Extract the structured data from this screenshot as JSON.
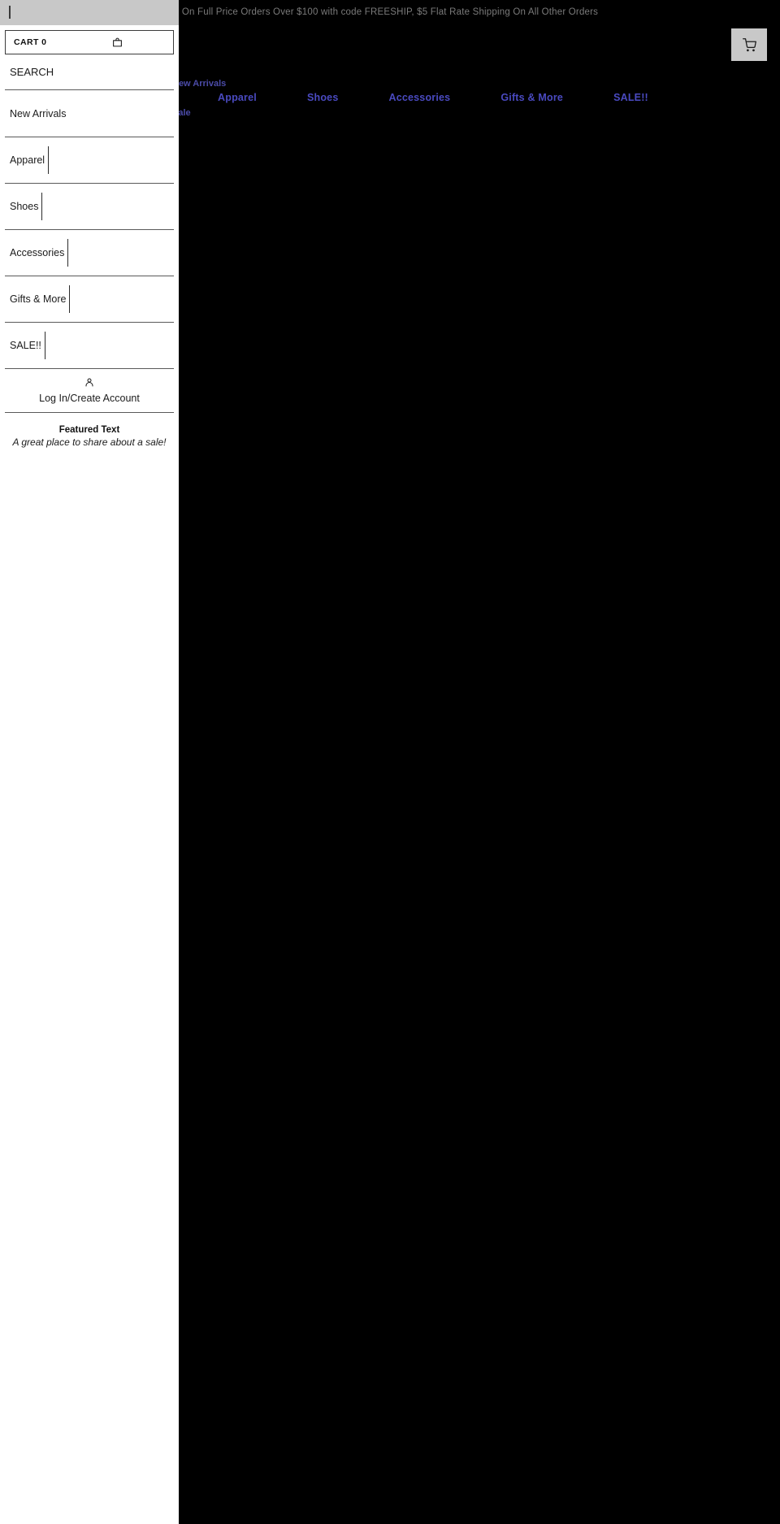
{
  "promo": {
    "text": "On Full Price Orders Over $100 with code FREESHIP, $5 Flat Rate Shipping On All Other Orders"
  },
  "header": {
    "cart_icon": "shopping-cart-icon"
  },
  "background_nav": {
    "new_arrivals": "New Arrivals",
    "sale_fragment": "Sale",
    "items": [
      {
        "label": "Apparel"
      },
      {
        "label": "Shoes"
      },
      {
        "label": "Accessories"
      },
      {
        "label": "Gifts & More"
      },
      {
        "label": "SALE!!"
      }
    ],
    "link_color": "#4a4ac0"
  },
  "drawer": {
    "close_icon": "close-bar-icon",
    "cart": {
      "label": "CART 0",
      "icon": "bag-icon"
    },
    "search": {
      "label": "SEARCH"
    },
    "menu": [
      {
        "label": "New Arrivals",
        "has_submenu": false
      },
      {
        "label": "Apparel",
        "has_submenu": true
      },
      {
        "label": "Shoes",
        "has_submenu": true
      },
      {
        "label": "Accessories",
        "has_submenu": true
      },
      {
        "label": "Gifts & More",
        "has_submenu": true
      },
      {
        "label": "SALE!!",
        "has_submenu": true
      }
    ],
    "account": {
      "label": "Log In/Create Account",
      "icon": "person-icon"
    },
    "featured": {
      "title": "Featured Text",
      "subtitle": "A great place to share about a sale!"
    }
  },
  "colors": {
    "page_bg": "#000000",
    "drawer_bg": "#ffffff",
    "topbar_bg": "#c8c8c8",
    "promo_text": "#7a7a7a",
    "nav_link": "#4a4ac0"
  }
}
